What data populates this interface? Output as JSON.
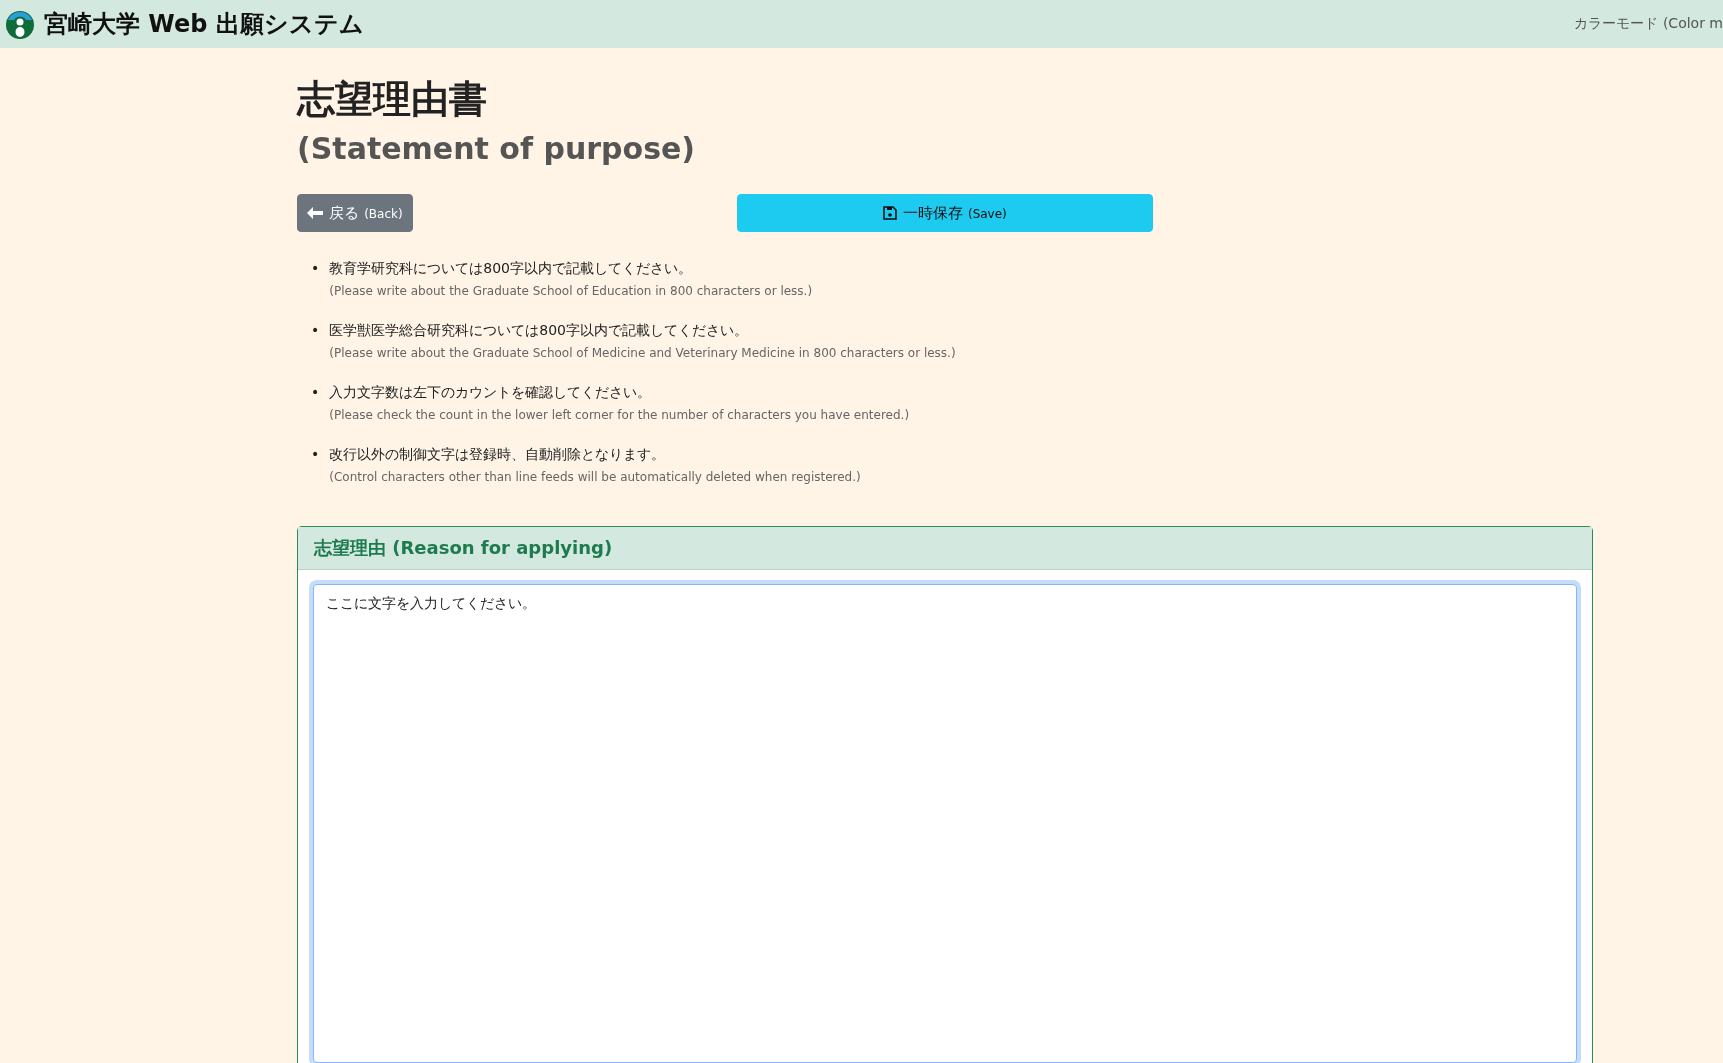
{
  "header": {
    "title": "宮崎大学 Web 出願システム",
    "color_mode": "カラーモード (Color m"
  },
  "page": {
    "title": "志望理由書",
    "subtitle": "(Statement of purpose)"
  },
  "buttons": {
    "back": {
      "label": "戻る",
      "sub": "(Back)"
    },
    "save": {
      "label": "一時保存",
      "sub": "(Save)"
    }
  },
  "notes": [
    {
      "bullet": "•",
      "text": "教育学研究科については800字以内で記載してください。",
      "sub": "(Please write about the Graduate School of Education in 800 characters or less.)"
    },
    {
      "bullet": "•",
      "text": "医学獣医学総合研究科については800字以内で記載してください。",
      "sub": "(Please write about the Graduate School of Medicine and Veterinary Medicine in 800 characters or less.)"
    },
    {
      "bullet": "•",
      "text": "入力文字数は左下のカウントを確認してください。",
      "sub": "(Please check the count in the lower left corner for the number of characters you have entered.)"
    },
    {
      "bullet": "•",
      "text": "改行以外の制御文字は登録時、自動削除となります。",
      "sub": "(Control characters other than line feeds will be automatically deleted when registered.)"
    }
  ],
  "card": {
    "title": "志望理由 (Reason for applying)",
    "value": "ここに文字を入力してください。"
  }
}
